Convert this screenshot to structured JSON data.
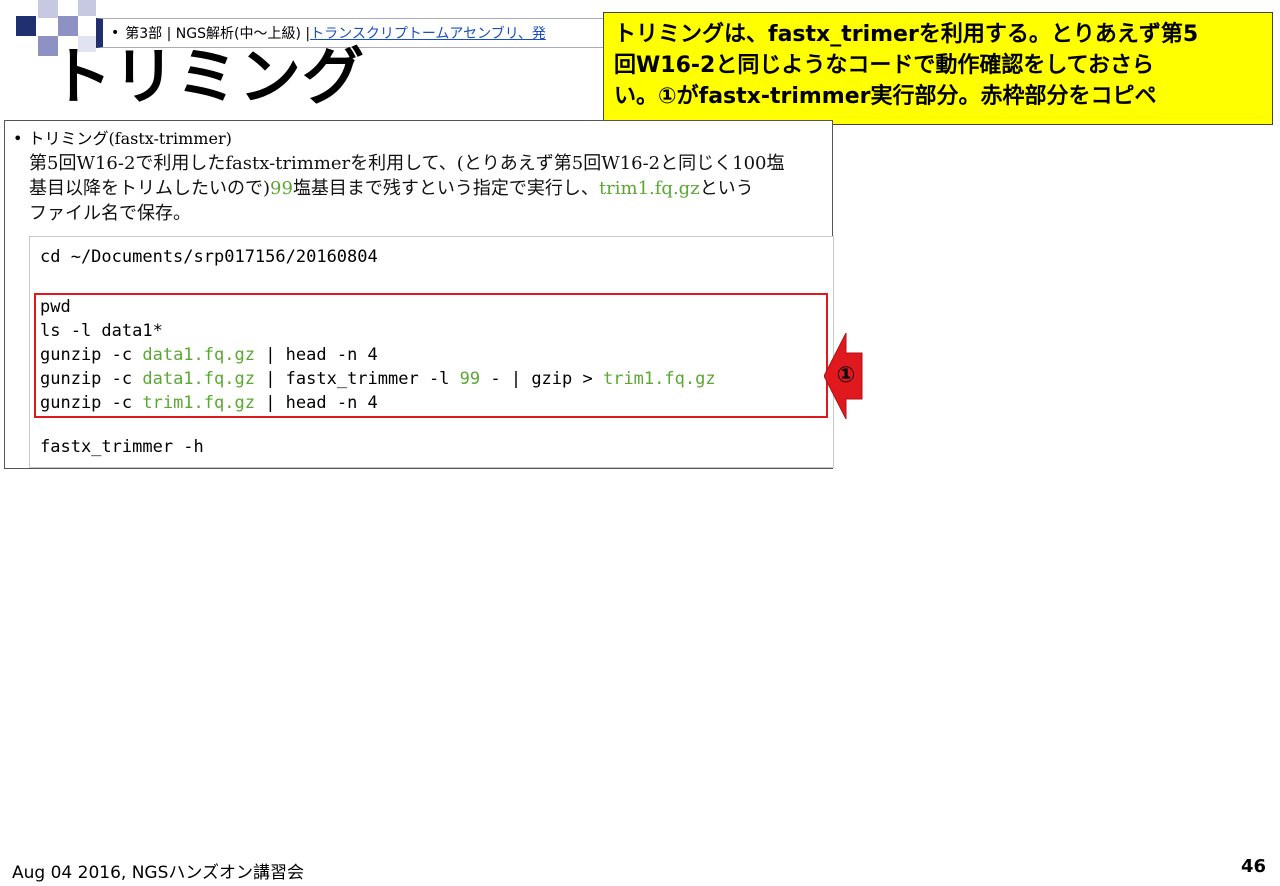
{
  "breadcrumb": {
    "part": "第3部 | NGS解析(中～上級) |",
    "link": "トランスクリプトームアセンブリ、発"
  },
  "title": "トリミング",
  "note": {
    "line1": "トリミングは、fastx_trimerを利用する。とりあえず第5",
    "line2": "回W16-2と同じようなコードで動作確認をしておさら",
    "line3": "い。①がfastx-trimmer実行部分。赤枠部分をコピペ"
  },
  "item": {
    "heading": "トリミング(fastx-trimmer)",
    "desc_parts": {
      "p1": "第5回W16-2で利用したfastx-trimmerを利用して、(とりあえず第5回W16-2と同じく100塩",
      "p2": "基目以降をトリムしたいので)",
      "p3": "99",
      "p4": "塩基目まで残すという指定で実行し、",
      "p5": "trim1.fq.gz",
      "p6": "という",
      "p7": "ファイル名で保存。"
    }
  },
  "code": {
    "line1": "cd ~/Documents/srp017156/20160804",
    "line2": "pwd",
    "line3": "ls -l data1*",
    "line4_a": "gunzip -c ",
    "line4_b": "data1.fq.gz",
    "line4_c": " | head -n 4",
    "line5_a": "gunzip -c ",
    "line5_b": "data1.fq.gz",
    "line5_c": " | fastx_trimmer -l ",
    "line5_d": "99",
    "line5_e": " - | gzip > ",
    "line5_f": "trim1.fq.gz",
    "line6_a": "gunzip -c ",
    "line6_b": "trim1.fq.gz",
    "line6_c": " | head -n 4",
    "line7": "fastx_trimmer -h"
  },
  "marker": "①",
  "footer": {
    "left": "Aug 04 2016, NGSハンズオン講習会",
    "page": "46"
  },
  "colors": {
    "navy": "#222f6e",
    "note_bg": "#ffff00",
    "highlight": "#e0191e",
    "code_green": "#5aa832"
  }
}
